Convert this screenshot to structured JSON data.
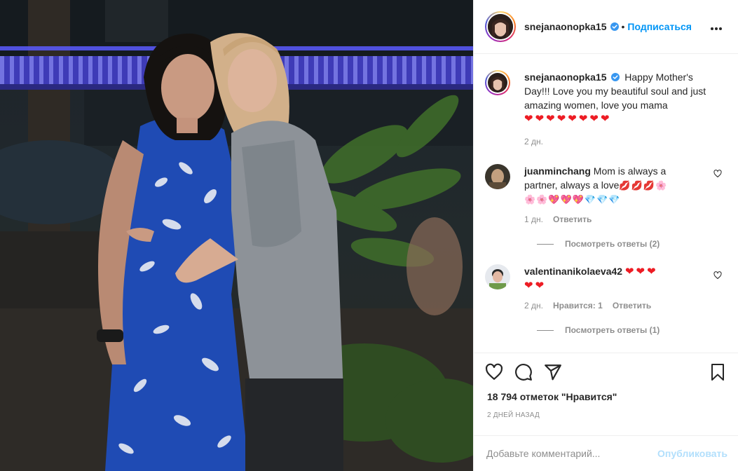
{
  "post": {
    "username": "snejanaonopka15",
    "dot": "•",
    "follow_label": "Подписаться",
    "caption_user": "snejanaonopka15",
    "caption_text": "Happy Mother's Day!!! Love you my beautiful soul and just amazing women, love you mama",
    "caption_emoji": "❤❤❤❤❤❤❤❤",
    "caption_time": "2 дн."
  },
  "comments": [
    {
      "user": "juanminchang",
      "text": "Mom is always a partner, always a love",
      "emoji_line1": "💋💋💋🌸",
      "emoji_line2": "🌸🌸💖💖💖💎💎💎",
      "time": "1 дн.",
      "reply": "Ответить",
      "view_replies": "Посмотреть ответы (2)"
    },
    {
      "user": "valentinanikolaeva42",
      "emoji_line1": "❤❤❤",
      "emoji_line2": "❤❤",
      "time": "2 дн.",
      "likes": "Нравится: 1",
      "reply": "Ответить",
      "view_replies": "Посмотреть ответы (1)"
    }
  ],
  "footer": {
    "likes": "18 794 отметок \"Нравится\"",
    "posted_ago": "2 дней назад",
    "comment_placeholder": "Добавьте комментарий...",
    "publish_label": "Опубликовать"
  },
  "icons": [
    "like-heart-icon",
    "comment-icon",
    "share-icon",
    "bookmark-icon",
    "more-options-icon",
    "verified-badge-icon"
  ],
  "colors": {
    "accent": "#0095f6",
    "muted": "#8e8e8e",
    "publish_disabled": "#b2dffc",
    "heart_red": "#ed1c24"
  }
}
